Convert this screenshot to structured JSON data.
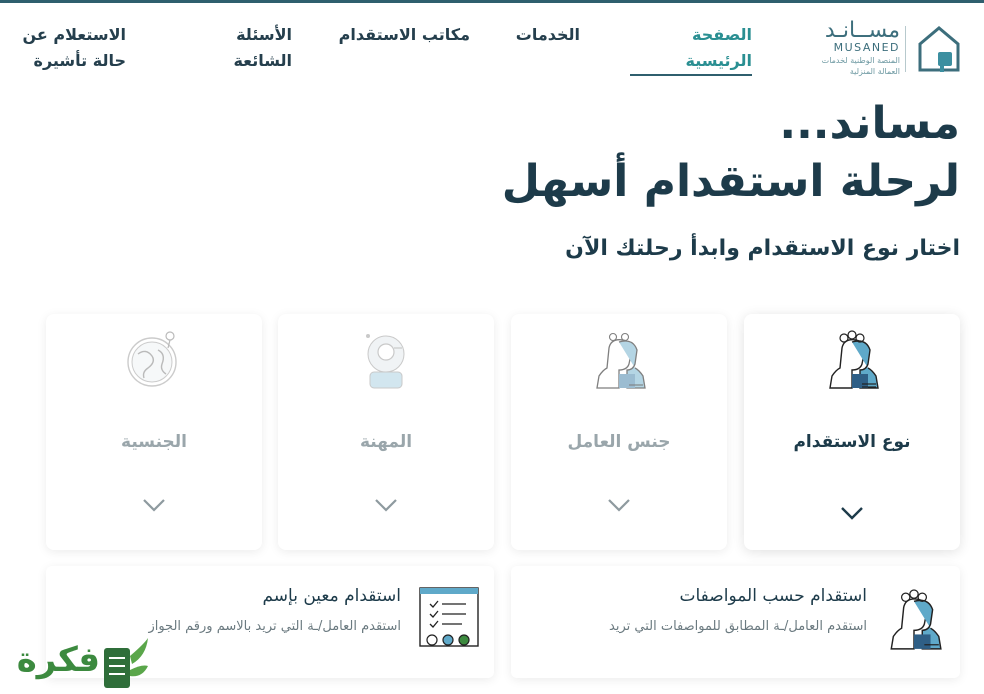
{
  "nav": {
    "home": "الصفحة الرئيسية",
    "services": "الخدمات",
    "offices": "مكاتب الاستقدام",
    "faq": "الأسئلة الشائعة",
    "visa": "الاستعلام عن حالة تأشيرة"
  },
  "logo": {
    "arabic": "مســانـد",
    "english": "MUSANED",
    "sub1": "المنصة الوطنية لخدمات",
    "sub2": "العمالة المنزلية"
  },
  "hero": {
    "line1": "مساند...",
    "line2": "لرحلة استقدام أسهل",
    "subtitle": "اختار نوع الاستقدام وابدأ رحلتك الآن"
  },
  "steps": [
    {
      "label": "نوع الاستقدام",
      "icon": "recruitment-type-icon"
    },
    {
      "label": "جنس العامل",
      "icon": "worker-gender-icon"
    },
    {
      "label": "المهنة",
      "icon": "profession-icon"
    },
    {
      "label": "الجنسية",
      "icon": "nationality-globe-icon"
    }
  ],
  "options": [
    {
      "title": "استقدام حسب المواصفات",
      "description": "استقدم العامل/ـة المطابق للمواصفات التي تريد",
      "icon": "people-profile-icon"
    },
    {
      "title": "استقدام معين بإسم",
      "description": "استقدم العامل/ـة التي تريد بالاسم ورقم الجواز",
      "icon": "document-list-icon"
    }
  ],
  "watermark": {
    "text": "فكرة"
  },
  "colors": {
    "primary": "#1d3b4a",
    "accent": "#2a8f92",
    "icon_blue": "#5fa9c9",
    "muted": "#9aa6ab",
    "watermark_green": "#3c8a3f"
  }
}
